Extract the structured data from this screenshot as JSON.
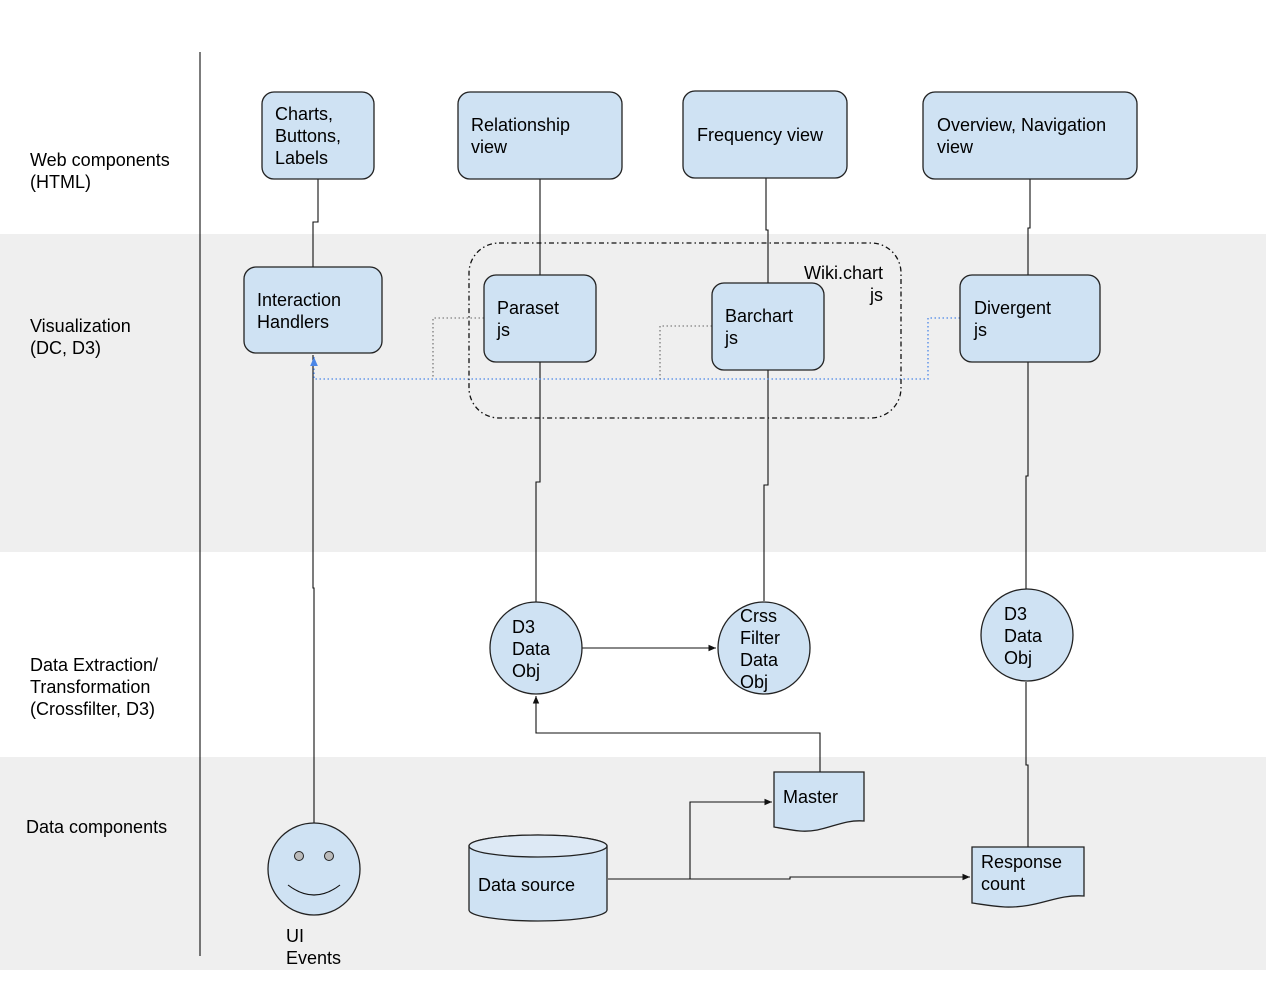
{
  "colors": {
    "band": "#efefef",
    "node_fill": "#cfe2f3",
    "interaction_link": "#4a86e8"
  },
  "layers": [
    {
      "lines": [
        "Web components",
        "(HTML)"
      ]
    },
    {
      "lines": [
        "Visualization",
        "(DC, D3)"
      ]
    },
    {
      "lines": [
        "Data Extraction/",
        "Transformation",
        "(Crossfilter, D3)"
      ]
    },
    {
      "lines": [
        "Data components"
      ]
    }
  ],
  "web_components": [
    {
      "lines": [
        "Charts,",
        "Buttons,",
        "Labels"
      ]
    },
    {
      "lines": [
        "Relationship",
        "view"
      ]
    },
    {
      "lines": [
        "Frequency view"
      ]
    },
    {
      "lines": [
        "Overview, Navigation",
        "view"
      ]
    }
  ],
  "visualization": {
    "interaction": {
      "lines": [
        "Interaction",
        "Handlers"
      ]
    },
    "group_label": [
      "Wiki.chart",
      "js"
    ],
    "paraset": {
      "lines": [
        "Paraset",
        "js"
      ]
    },
    "barchart": {
      "lines": [
        "Barchart",
        "js"
      ]
    },
    "divergent": {
      "lines": [
        "Divergent",
        "js"
      ]
    }
  },
  "data_objects": [
    {
      "lines": [
        "D3",
        "Data",
        "Obj"
      ]
    },
    {
      "lines": [
        "Crss",
        "Filter",
        "Data",
        "Obj"
      ]
    },
    {
      "lines": [
        "D3",
        "Data",
        "Obj"
      ]
    }
  ],
  "data_components": {
    "source": "Data source",
    "master": "Master",
    "response": [
      "Response",
      "count"
    ],
    "ui_events": [
      "UI",
      "Events"
    ],
    "user_icon": "smiley-face-icon"
  }
}
